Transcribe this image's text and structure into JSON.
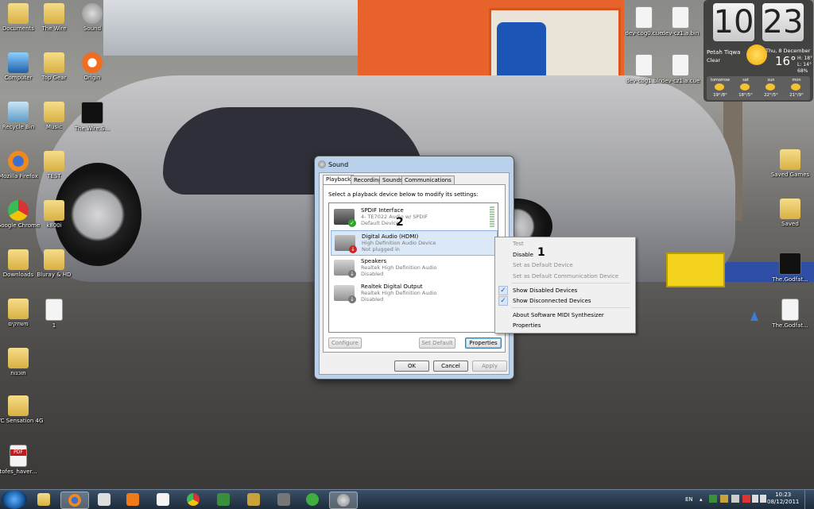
{
  "desktop_icons": [
    {
      "label": "Documents",
      "type": "folder"
    },
    {
      "label": "The Wire",
      "type": "folder"
    },
    {
      "label": "Sound",
      "type": "speaker"
    },
    {
      "label": "Computer",
      "type": "computer"
    },
    {
      "label": "Top Gear",
      "type": "folder"
    },
    {
      "label": "Origin",
      "type": "origin"
    },
    {
      "label": "Recycle Bin",
      "type": "bin"
    },
    {
      "label": "Music",
      "type": "folder"
    },
    {
      "label": "The.Wire.S...",
      "type": "hbo"
    },
    {
      "label": "Mozilla Firefox",
      "type": "firefox"
    },
    {
      "label": "TEST",
      "type": "folder"
    },
    {
      "label": "Google Chrome",
      "type": "chrome"
    },
    {
      "label": "k800i",
      "type": "folder"
    },
    {
      "label": "Downloads",
      "type": "folder"
    },
    {
      "label": "Bluray & HD",
      "type": "folder"
    },
    {
      "label": "משחקים",
      "type": "folder"
    },
    {
      "label": "1",
      "type": "file"
    },
    {
      "label": "תוכנות",
      "type": "folder"
    },
    {
      "label": "HTC Sensation 4G",
      "type": "folder"
    },
    {
      "label": "tofes_haver...",
      "type": "pdf"
    },
    {
      "label": "dev-cog0.cue",
      "type": "doc"
    },
    {
      "label": "dev-cz1.a.bin",
      "type": "doc"
    },
    {
      "label": "dev-cog1.bin",
      "type": "doc"
    },
    {
      "label": "dev-cz1.a.cue",
      "type": "doc"
    },
    {
      "label": "Saved Games",
      "type": "folder"
    },
    {
      "label": "Saved",
      "type": "folder"
    },
    {
      "label": "The.Godfat...",
      "type": "video"
    },
    {
      "label": "The.Godfat...",
      "type": "file"
    }
  ],
  "weather_gadget": {
    "hour": "10",
    "minute": "23",
    "date": "Thu, 8 December",
    "city": "Petah Tiqwa",
    "condition": "Clear",
    "temp": "16°",
    "hi": "H: 18°",
    "lo": "L: 14°",
    "humidity": "68%",
    "forecast": [
      {
        "day": "tomorrow",
        "range": "19°/8°"
      },
      {
        "day": "sat",
        "range": "18°/5°"
      },
      {
        "day": "sun",
        "range": "22°/5°"
      },
      {
        "day": "mon",
        "range": "21°/9°"
      }
    ]
  },
  "sound_dialog": {
    "title": "Sound",
    "tabs": [
      "Playback",
      "Recording",
      "Sounds",
      "Communications"
    ],
    "instruction": "Select a playback device below to modify its settings:",
    "devices": [
      {
        "name": "SPDIF Interface",
        "detail": "4- TE7022 Audio w/ SPDIF",
        "status": "Default Device",
        "badge": "✓",
        "badge_color": "#2fa32f"
      },
      {
        "name": "Digital Audio (HDMI)",
        "detail": "High Definition Audio Device",
        "status": "Not plugged in",
        "badge": "↓",
        "badge_color": "#c62828"
      },
      {
        "name": "Speakers",
        "detail": "Realtek High Definition Audio",
        "status": "Disabled",
        "badge": "↓",
        "badge_color": "#777"
      },
      {
        "name": "Realtek Digital Output",
        "detail": "Realtek High Definition Audio",
        "status": "Disabled",
        "badge": "↓",
        "badge_color": "#777"
      }
    ],
    "configure": "Configure",
    "set_default": "Set Default",
    "properties": "Properties",
    "ok": "OK",
    "cancel": "Cancel",
    "apply": "Apply"
  },
  "context_menu": {
    "test": "Test",
    "disable": "Disable",
    "set_default": "Set as Default Device",
    "set_default_comm": "Set as Default Communication Device",
    "show_disabled": "Show Disabled Devices",
    "show_disconnected": "Show Disconnected Devices",
    "about": "About Software MIDI Synthesizer",
    "properties": "Properties"
  },
  "annotations": {
    "one": "1",
    "two": "2"
  },
  "taskbar": {
    "lang": "EN",
    "time": "10:23",
    "date": "08/12/2011",
    "apps": [
      "explorer",
      "firefox",
      "media",
      "mail",
      "calendar",
      "chrome",
      "app-x",
      "app-pen",
      "speaker",
      "utorrent",
      "app-sound"
    ]
  }
}
